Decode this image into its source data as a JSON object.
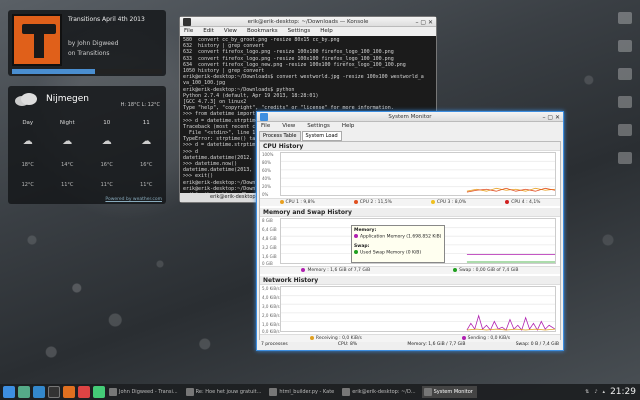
{
  "music": {
    "title": "Transitions April 4th 2013",
    "by": "by John Digweed",
    "on": "on Transitions",
    "progress": 0.55
  },
  "weather": {
    "city": "Nijmegen",
    "hilo": "H: 18°C L: 12°C",
    "days": [
      "Day",
      "Night",
      "10",
      "11"
    ],
    "highs": [
      "18°C",
      "14°C",
      "16°C",
      "16°C"
    ],
    "lows": [
      "12°C",
      "11°C",
      "11°C",
      "11°C"
    ],
    "credit": "Powered by weather.com"
  },
  "konsole": {
    "title": "erik@erik-desktop: ~/Downloads — Konsole",
    "menu": [
      "File",
      "Edit",
      "View",
      "Bookmarks",
      "Settings",
      "Help"
    ],
    "lines": [
      "580  convert cc_by_groot.png -resize 80x15 cc_by.png",
      "632  history | grep convert",
      "632  convert firefox_logo.png -resize 100x100 firefox_logo_100_100.png",
      "633  convert firefox_logo.png -resize 100x100 firefox_logo_100_100.png",
      "634  convert firefox_logo_new.png -resize 100x100 firefox_logo_100_100.png",
      "1050 history | grep convert",
      "erik@erik-desktop:~/Downloads$ convert westworld.jpg -resize 100x100 westworld_a",
      "va_100_100.jpg",
      "erik@erik-desktop:~/Downloads$ python",
      "Python 2.7.4 (default, Apr 19 2013, 18:28:01)",
      "[GCC 4.7.3] on linux2",
      "Type \"help\", \"copyright\", \"credits\" or \"license\" for more information.",
      ">>> from datetime import datetime",
      ">>> d = datetime.strptime",
      "Traceback (most recent c",
      "  File \"<stdin>\", line 1",
      "TypeError: strptime() ta",
      ">>> d = datetime.strptim",
      ">>> d",
      "datetime.datetime(2012,",
      ">>> datetime.now()",
      "datetime.datetime(2013,",
      ">>> exit()",
      "erik@erik-desktop:~/Downl",
      "erik@erik-desktop:~/Downl",
      "erik@erik-desktop:~/Downl"
    ],
    "tab": "erik@erik-desktop: ~/Do"
  },
  "sysmon": {
    "title": "System Monitor",
    "menu": [
      "File",
      "View",
      "Settings",
      "Help"
    ],
    "tabs": [
      "Process Table",
      "System Load"
    ],
    "cpu": {
      "heading": "CPU History",
      "ticks": [
        "100%",
        "80%",
        "60%",
        "40%",
        "20%",
        "0%"
      ],
      "legend": [
        {
          "label": "CPU 1 : 9,8%",
          "color": "#e8a020"
        },
        {
          "label": "CPU 2 : 11,5%",
          "color": "#e05020"
        },
        {
          "label": "CPU 3 : 8,0%",
          "color": "#f0c020"
        },
        {
          "label": "CPU 4 : 4,1%",
          "color": "#d02020"
        }
      ]
    },
    "mem": {
      "heading": "Memory and Swap History",
      "ticks": [
        "8 GiB",
        "6,4 GiB",
        "4,8 GiB",
        "3,2 GiB",
        "1,6 GiB",
        "0 GiB"
      ],
      "legend": [
        {
          "label": "Memory : 1,6 GiB of 7,7 GiB",
          "color": "#b020b0"
        },
        {
          "label": "Swap : 0,00 GiB of 7,4 GiB",
          "color": "#20a020"
        }
      ],
      "tooltip_mem_title": "Memory:",
      "tooltip_mem": "Application Memory (1.698.852 KiB)",
      "tooltip_swap_title": "Swap:",
      "tooltip_swap": "Used Swap Memory (0 KiB)"
    },
    "net": {
      "heading": "Network History",
      "ticks": [
        "5,0 KiB/s",
        "4,0 KiB/s",
        "3,0 KiB/s",
        "2,0 KiB/s",
        "1,0 KiB/s",
        "0,0 KiB/s"
      ],
      "legend": [
        {
          "label": "Receiving : 0,0 KiB/s",
          "color": "#e0a020"
        },
        {
          "label": "Sending : 0,0 KiB/s",
          "color": "#b020b0"
        }
      ]
    },
    "status": [
      "7 processes",
      "CPU: 8%",
      "Memory: 1,6 GiB / 7,7 GiB",
      "Swap: 0 B / 7,4 GiB"
    ]
  },
  "taskbar": {
    "tasks": [
      {
        "label": "John Digweed - Transi...",
        "active": false
      },
      {
        "label": "Re: Hoe het jouw gratuit...",
        "active": false
      },
      {
        "label": "html_builder.py - Kate",
        "active": false
      },
      {
        "label": "erik@erik-desktop: ~/D...",
        "active": false
      },
      {
        "label": "System Monitor",
        "active": true
      }
    ],
    "clock": "21:29"
  },
  "colors": {
    "accent": "#3d8ee0",
    "music_cover": "#e0601a"
  }
}
